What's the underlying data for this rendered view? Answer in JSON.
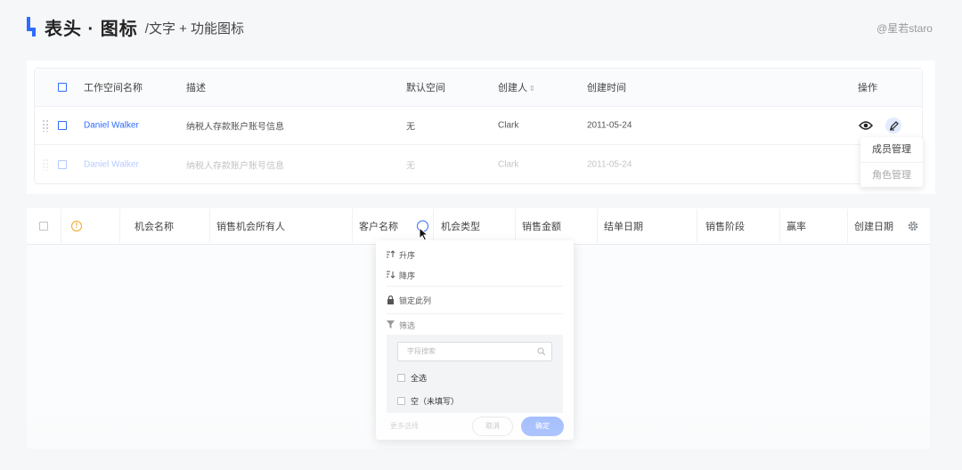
{
  "header": {
    "title": "表头 · 图标",
    "subtitle": "/文字 + 功能图标",
    "author": "@星若staro"
  },
  "table1": {
    "columns": [
      "工作空间名称",
      "描述",
      "默认空间",
      "创建人",
      "创建时间",
      "操作"
    ],
    "sort_glyph": "⇕",
    "rows": [
      {
        "name": "Daniel Walker",
        "desc": "纳税人存款账户账号信息",
        "default": "无",
        "creator": "Clark",
        "date": "2011-05-24"
      },
      {
        "name": "Daniel Walker",
        "desc": "纳税人存款账户账号信息",
        "default": "无",
        "creator": "Clark",
        "date": "2011-05-24"
      }
    ],
    "action_menu": [
      "成员管理",
      "角色管理"
    ]
  },
  "table2": {
    "columns": [
      "机会名称",
      "销售机会所有人",
      "客户名称",
      "机会类型",
      "销售金额",
      "结单日期",
      "销售阶段",
      "赢率",
      "创建日期"
    ],
    "warn_glyph": "!"
  },
  "dropdown": {
    "sort_asc": "升序",
    "sort_desc": "降序",
    "lock_column": "锁定此列",
    "filter": "筛选",
    "search_placeholder": "字段搜索",
    "select_all": "全选",
    "empty_option": "空（未填写）",
    "more_select": "更多选择",
    "cancel": "取消",
    "confirm": "确定"
  },
  "colors": {
    "accent": "#2f6bff",
    "warning": "#f5a623"
  }
}
